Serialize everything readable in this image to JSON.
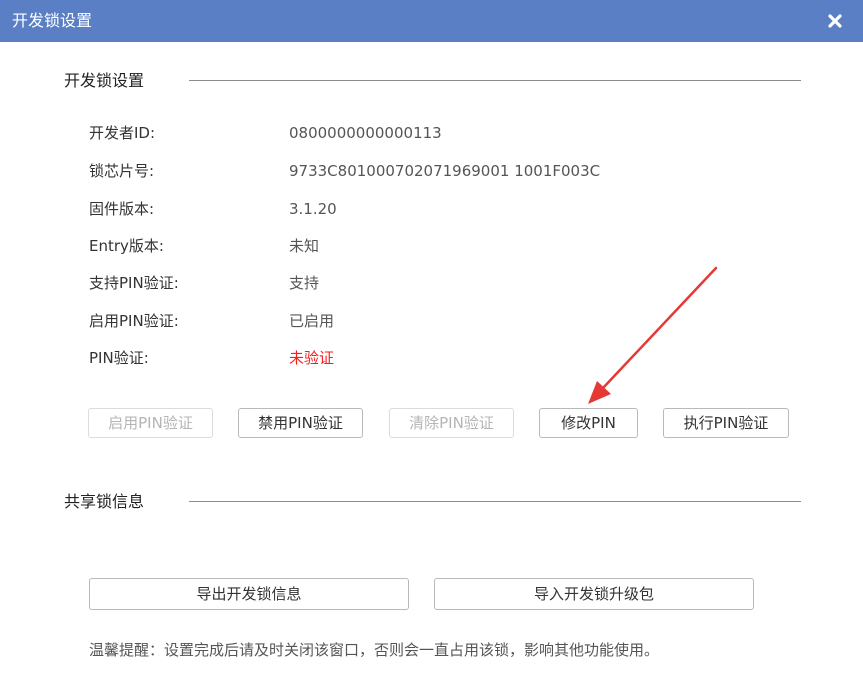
{
  "window": {
    "title": "开发锁设置"
  },
  "dev_lock": {
    "section_title": "开发锁设置",
    "rows": [
      {
        "label": "开发者ID:",
        "value": "0800000000000113"
      },
      {
        "label": "锁芯片号:",
        "value": "9733C801000702071969001 1001F003C"
      },
      {
        "label": "固件版本:",
        "value": "3.1.20"
      },
      {
        "label": "Entry版本:",
        "value": "未知"
      },
      {
        "label": "支持PIN验证:",
        "value": "支持"
      },
      {
        "label": "启用PIN验证:",
        "value": "已启用"
      },
      {
        "label": "PIN验证:",
        "value": "未验证"
      }
    ],
    "buttons": {
      "enable_pin": "启用PIN验证",
      "disable_pin": "禁用PIN验证",
      "clear_pin": "清除PIN验证",
      "change_pin": "修改PIN",
      "verify_pin": "执行PIN验证"
    }
  },
  "shared_lock": {
    "section_title": "共享锁信息",
    "export_button": "导出开发锁信息",
    "import_button": "导入开发锁升级包"
  },
  "tip": "温馨提醒：设置完成后请及时关闭该窗口，否则会一直占用该锁，影响其他功能使用。",
  "colors": {
    "titlebar": "#5b7fc4",
    "warning_value": "#ff1a1a",
    "annotation_arrow": "#e53935"
  },
  "icons": {
    "close": "close-icon"
  }
}
